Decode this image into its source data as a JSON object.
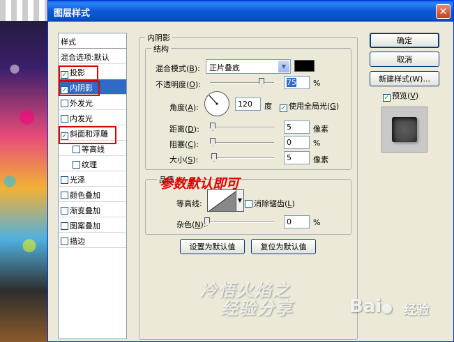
{
  "window": {
    "title": "图层样式",
    "close_glyph": "✕"
  },
  "styles_list": {
    "header": "样式",
    "items": [
      {
        "label": "混合选项:默认",
        "checkbox": false,
        "checked": false,
        "selected": false,
        "indent": false
      },
      {
        "label": "投影",
        "checkbox": true,
        "checked": true,
        "selected": false,
        "indent": false
      },
      {
        "label": "内阴影",
        "checkbox": true,
        "checked": true,
        "selected": true,
        "indent": false
      },
      {
        "label": "外发光",
        "checkbox": true,
        "checked": false,
        "selected": false,
        "indent": false
      },
      {
        "label": "内发光",
        "checkbox": true,
        "checked": false,
        "selected": false,
        "indent": false
      },
      {
        "label": "斜面和浮雕",
        "checkbox": true,
        "checked": true,
        "selected": false,
        "indent": false
      },
      {
        "label": "等高线",
        "checkbox": true,
        "checked": false,
        "selected": false,
        "indent": true
      },
      {
        "label": "纹理",
        "checkbox": true,
        "checked": false,
        "selected": false,
        "indent": true
      },
      {
        "label": "光泽",
        "checkbox": true,
        "checked": false,
        "selected": false,
        "indent": false
      },
      {
        "label": "颜色叠加",
        "checkbox": true,
        "checked": false,
        "selected": false,
        "indent": false
      },
      {
        "label": "渐变叠加",
        "checkbox": true,
        "checked": false,
        "selected": false,
        "indent": false
      },
      {
        "label": "图案叠加",
        "checkbox": true,
        "checked": false,
        "selected": false,
        "indent": false
      },
      {
        "label": "描边",
        "checkbox": true,
        "checked": false,
        "selected": false,
        "indent": false
      }
    ]
  },
  "inner_shadow": {
    "group_title": "内阴影",
    "structure": {
      "title": "结构",
      "blend_mode_label": "混合模式(",
      "blend_mode_key": "B",
      "blend_mode_value": "正片叠底",
      "blend_color": "#000000",
      "opacity_label": "不透明度(",
      "opacity_key": "O",
      "opacity_value": "75",
      "opacity_level": 0.75,
      "angle_label": "角度(",
      "angle_key": "A",
      "angle_value": "120",
      "angle_unit": "度",
      "global_light_label": "使用全局光(",
      "global_light_key": "G",
      "global_light_checked": true,
      "distance_label": "距离(",
      "distance_key": "D",
      "distance_value": "5",
      "distance_unit": "像素",
      "choke_label": "阻塞(",
      "choke_key": "C",
      "choke_value": "0",
      "choke_unit": "%",
      "size_label": "大小(",
      "size_key": "S",
      "size_value": "5",
      "size_unit": "像素",
      "percent_unit": "%"
    },
    "quality": {
      "title": "品质",
      "contour_label": "等高线:",
      "anti_alias_label": "消除锯齿(",
      "anti_alias_key": "L",
      "anti_alias_checked": false,
      "noise_label": "杂色(",
      "noise_key": "N",
      "noise_value": "0",
      "noise_unit": "%"
    },
    "make_default_label": "设置为默认值",
    "reset_default_label": "复位为默认值"
  },
  "right_buttons": {
    "ok": "确定",
    "cancel": "取消",
    "new_style": "新建样式(W)...",
    "preview_label": "预览(",
    "preview_key": "V",
    "preview_checked": true
  },
  "annotation": "参数默认即可",
  "watermark_line1": "冷悟火焰之",
  "watermark_line2": "经验分享",
  "brand_text": "Bai",
  "brand_suffix": "经验",
  "colors": {
    "titlebar": "#0a58d6",
    "selection": "#316ac5",
    "highlight": "#e00000",
    "dialog": "#ece9d8"
  }
}
